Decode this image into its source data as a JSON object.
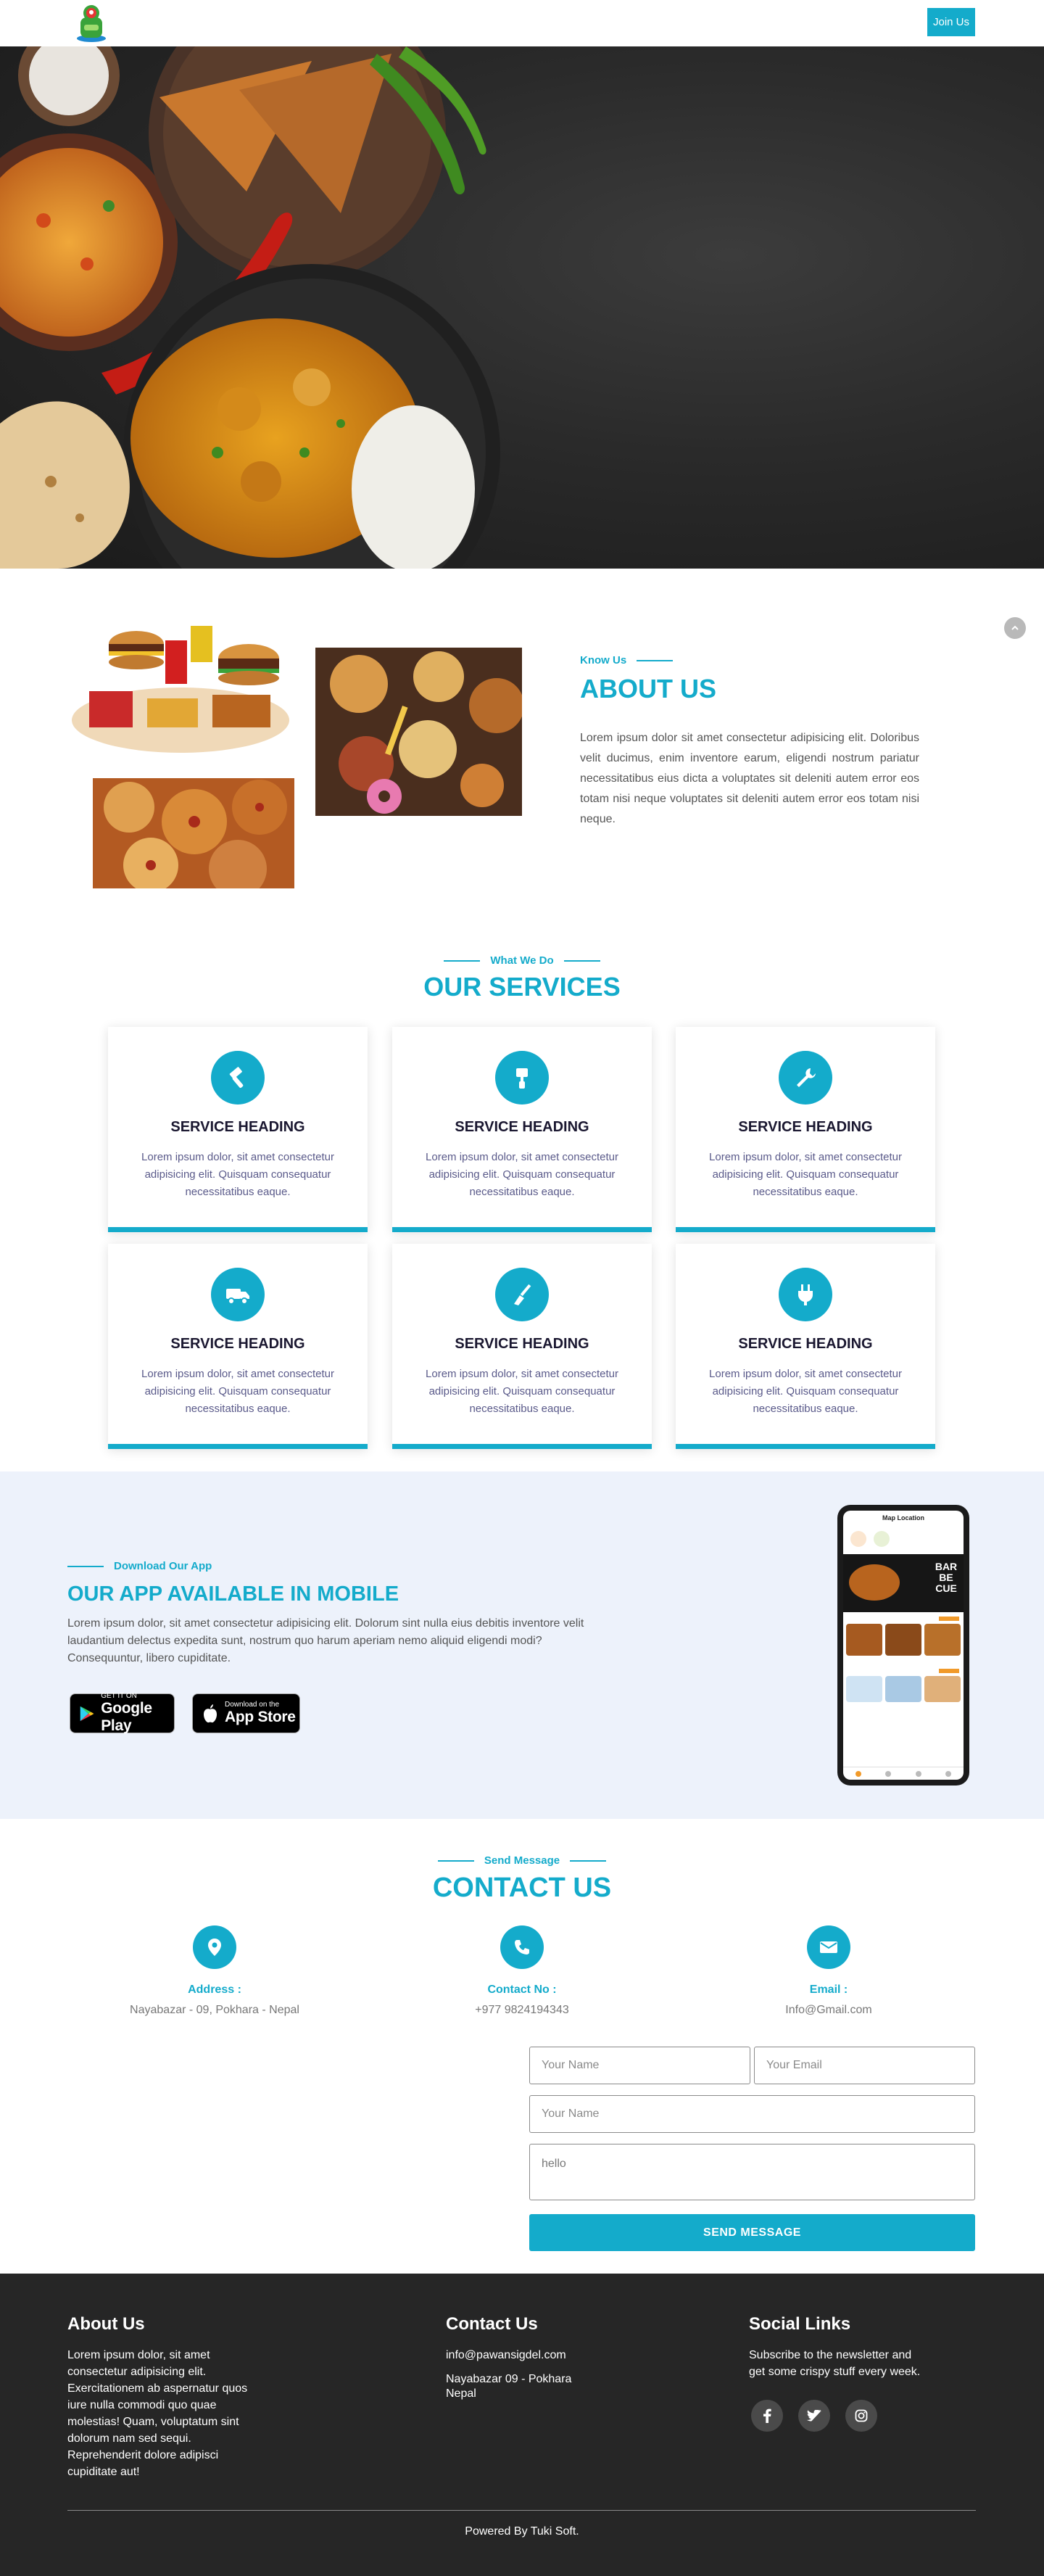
{
  "nav": {
    "join_label": "Join Us"
  },
  "about": {
    "kicker": "Know Us",
    "title": "ABOUT US",
    "text": "Lorem ipsum dolor sit amet consectetur adipisicing elit. Doloribus velit ducimus, enim inventore earum, eligendi nostrum pariatur necessitatibus eius dicta a voluptates sit deleniti autem error eos totam nisi neque voluptates sit deleniti autem error eos totam nisi neque."
  },
  "services": {
    "kicker": "What We Do",
    "title": "OUR SERVICES",
    "cards": [
      {
        "icon": "hammer-icon",
        "heading": "SERVICE HEADING",
        "text": "Lorem ipsum dolor, sit amet consectetur adipisicing elit. Quisquam consequatur necessitatibus eaque."
      },
      {
        "icon": "paint-roller-icon",
        "heading": "SERVICE HEADING",
        "text": "Lorem ipsum dolor, sit amet consectetur adipisicing elit. Quisquam consequatur necessitatibus eaque."
      },
      {
        "icon": "wrench-icon",
        "heading": "SERVICE HEADING",
        "text": "Lorem ipsum dolor, sit amet consectetur adipisicing elit. Quisquam consequatur necessitatibus eaque."
      },
      {
        "icon": "truck-icon",
        "heading": "SERVICE HEADING",
        "text": "Lorem ipsum dolor, sit amet consectetur adipisicing elit. Quisquam consequatur necessitatibus eaque."
      },
      {
        "icon": "broom-icon",
        "heading": "SERVICE HEADING",
        "text": "Lorem ipsum dolor, sit amet consectetur adipisicing elit. Quisquam consequatur necessitatibus eaque."
      },
      {
        "icon": "plug-icon",
        "heading": "SERVICE HEADING",
        "text": "Lorem ipsum dolor, sit amet consectetur adipisicing elit. Quisquam consequatur necessitatibus eaque."
      }
    ]
  },
  "app": {
    "kicker": "Download Our App",
    "title": "OUR APP AVAILABLE IN MOBILE",
    "text": "Lorem ipsum dolor, sit amet consectetur adipisicing elit. Dolorum sint nulla eius debitis inventore velit laudantium delectus expedita sunt, nostrum quo harum aperiam nemo aliquid eligendi modi? Consequuntur, libero cupiditate.",
    "google_play": {
      "small": "GET IT ON",
      "big": "Google Play"
    },
    "app_store": {
      "small": "Download on the",
      "big": "App Store"
    },
    "phone": {
      "header": "Map Location",
      "banner": "BAR BE CUE"
    }
  },
  "contact": {
    "kicker": "Send Message",
    "title": "CONTACT US",
    "address_label": "Address :",
    "address_value": "Nayabazar - 09, Pokhara - Nepal",
    "phone_label": "Contact No :",
    "phone_value": "+977 9824194343",
    "email_label": "Email :",
    "email_value": "Info@Gmail.com",
    "form": {
      "name_placeholder": "Your Name",
      "email_placeholder": "Your Email",
      "name2_placeholder": "Your Name",
      "message_value": "hello",
      "send_label": "SEND MESSAGE"
    }
  },
  "footer": {
    "about_head": "About Us",
    "about_text": "Lorem ipsum dolor, sit amet consectetur adipisicing elit. Exercitationem ab aspernatur quos iure nulla commodi quo quae molestias! Quam, voluptatum sint dolorum nam sed sequi. Reprehenderit dolore adipisci cupiditate aut!",
    "contact_head": "Contact Us",
    "contact_email": "info@pawansigdel.com",
    "contact_address": "Nayabazar 09 - Pokhara Nepal",
    "social_head": "Social Links",
    "social_text": "Subscribe to the newsletter and get some crispy stuff every week.",
    "powered": "Powered By Tuki Soft."
  },
  "colors": {
    "accent": "#14abcb",
    "footer_bg": "#262626",
    "app_bg": "#edf2fb",
    "heading_dark": "#1a1730"
  }
}
